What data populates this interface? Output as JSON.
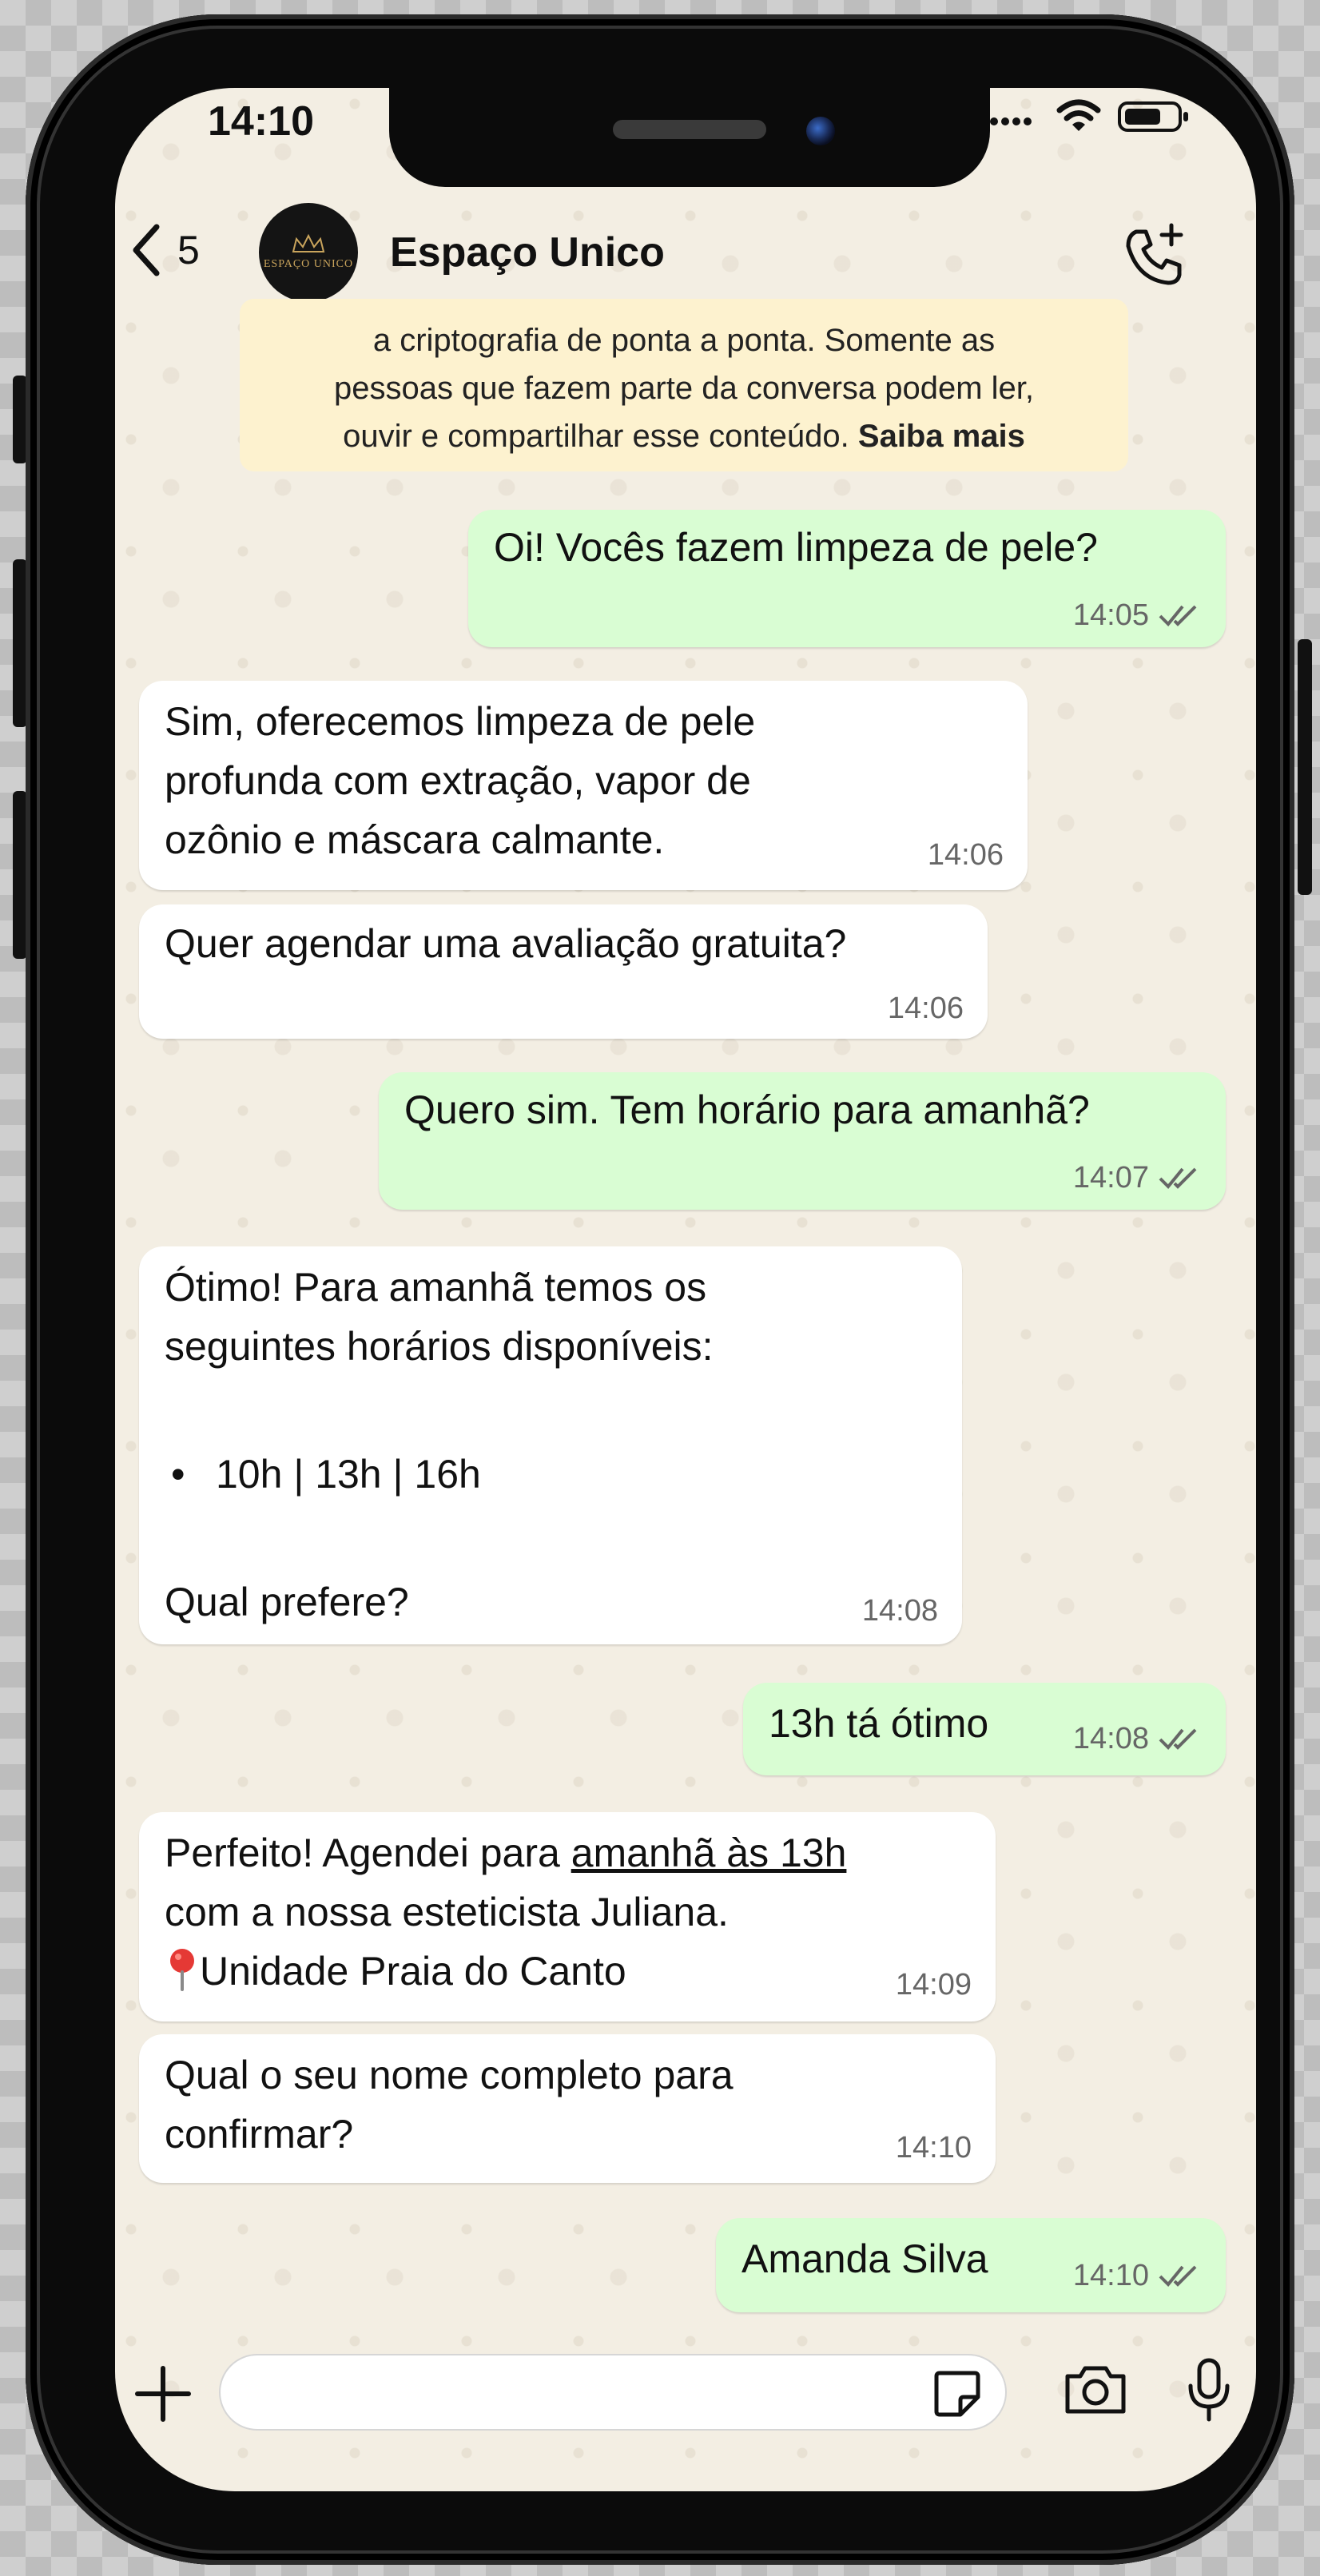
{
  "status_bar": {
    "time": "14:10"
  },
  "header": {
    "back_count": "5",
    "contact_name": "Espaço Unico",
    "avatar_text": "ESPAÇO UNICO"
  },
  "notice": {
    "line1": "a criptografia de ponta a ponta. Somente as",
    "line2": "pessoas que fazem parte da conversa podem ler,",
    "line3_prefix": "ouvir e compartilhar esse conteúdo. ",
    "link": "Saiba mais"
  },
  "messages": [
    {
      "direction": "out",
      "lines": [
        "Oi! Vocês fazem limpeza de pele?"
      ],
      "time": "14:05",
      "read": true
    },
    {
      "direction": "in",
      "lines": [
        "Sim, oferecemos limpeza de pele",
        "profunda com extração, vapor de",
        "ozônio e máscara calmante."
      ],
      "time": "14:06"
    },
    {
      "direction": "in",
      "lines": [
        "Quer agendar uma avaliação gratuita?"
      ],
      "time": "14:06"
    },
    {
      "direction": "out",
      "lines": [
        "Quero sim. Tem horário para amanhã?"
      ],
      "time": "14:07",
      "read": true
    },
    {
      "direction": "in",
      "lines": [
        "Ótimo! Para amanhã temos os",
        "seguintes horários disponíveis:"
      ],
      "bullet": "10h | 13h | 16h",
      "closing": "Qual prefere?",
      "time": "14:08"
    },
    {
      "direction": "out",
      "lines": [
        "13h tá ótimo"
      ],
      "time": "14:08",
      "read": true
    },
    {
      "direction": "in",
      "lines": [
        "Perfeito! Agendei para ",
        "amanhã às 13h",
        "com a nossa esteticista Juliana.",
        "Unidade Praia do Canto"
      ],
      "time": "14:09"
    },
    {
      "direction": "in",
      "lines": [
        "Qual o seu nome completo para",
        "confirmar?"
      ],
      "time": "14:10"
    },
    {
      "direction": "out",
      "lines": [
        "Amanda Silva"
      ],
      "time": "14:10",
      "read": true
    }
  ],
  "composer": {
    "placeholder": ""
  },
  "colors": {
    "outgoing_bubble": "#d9fdd3",
    "incoming_bubble": "#ffffff",
    "chat_bg": "#f3eee3",
    "notice_bg": "#fdf2cf",
    "read_ticks": "#666666"
  }
}
